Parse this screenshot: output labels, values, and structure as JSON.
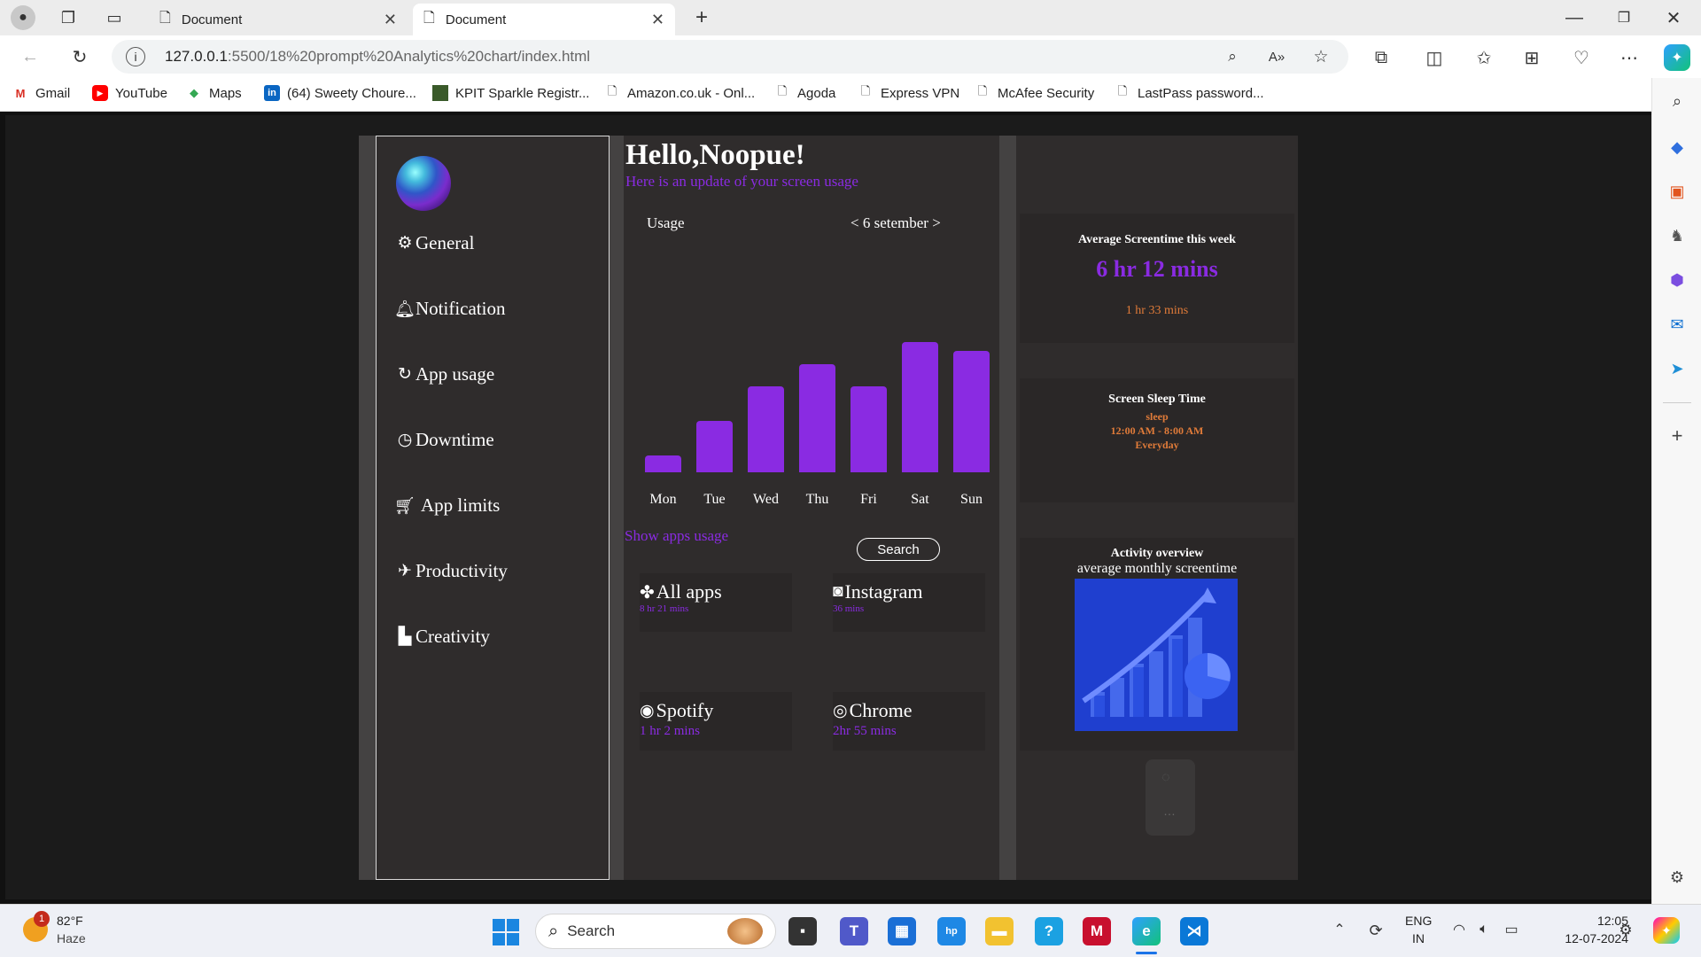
{
  "browser": {
    "tabs": [
      {
        "title": "Document"
      },
      {
        "title": "Document"
      }
    ],
    "url_host": "127.0.0.1",
    "url_rest": ":5500/18%20prompt%20Analytics%20chart/index.html",
    "bookmarks": [
      "Gmail",
      "YouTube",
      "Maps",
      "(64) Sweety Choure...",
      "KPIT Sparkle Registr...",
      "Amazon.co.uk - Onl...",
      "Agoda",
      "Express VPN",
      "McAfee Security",
      "LastPass password..."
    ]
  },
  "nav": {
    "items": [
      {
        "label": "General",
        "icon": "gear-icon"
      },
      {
        "label": "Notification",
        "icon": "bell-icon"
      },
      {
        "label": "App usage",
        "icon": "refresh-icon"
      },
      {
        "label": "Downtime",
        "icon": "clock-icon"
      },
      {
        "label": "App limits",
        "icon": "cart-icon"
      },
      {
        "label": "Productivity",
        "icon": "plane-icon"
      },
      {
        "label": "Creativity",
        "icon": "monitor-icon"
      }
    ]
  },
  "header": {
    "greeting": "Hello,Noopue!",
    "subtitle": "Here is an update of your screen usage"
  },
  "usage": {
    "title": "Usage",
    "date_label": "< 6 setember >"
  },
  "chart_data": {
    "type": "bar",
    "categories": [
      "Mon",
      "Tue",
      "Wed",
      "Thu",
      "Fri",
      "Sat",
      "Sun"
    ],
    "values": [
      13,
      40,
      67,
      84,
      67,
      101,
      94
    ],
    "ylim": [
      0,
      110
    ],
    "grid": false,
    "color": "#8a2be2"
  },
  "apps": {
    "heading": "Show apps usage",
    "search_label": "Search",
    "items": [
      {
        "name": "All apps",
        "time": "8 hr 21 mins",
        "icon": "apps-grid-icon"
      },
      {
        "name": "Instagram",
        "time": "36 mins",
        "icon": "instagram-icon"
      },
      {
        "name": "Spotify",
        "time": "1 hr 2 mins",
        "icon": "spotify-icon"
      },
      {
        "name": "Chrome",
        "time": "2hr 55 mins",
        "icon": "chrome-icon"
      }
    ]
  },
  "summary": {
    "avg_title": "Average Screentime this week",
    "avg_value": "6 hr 12 mins",
    "avg_sub": "1 hr 33 mins",
    "sleep_title": "Screen Sleep Time",
    "sleep_label": "sleep",
    "sleep_time": "12:00 AM - 8:00 AM",
    "sleep_days": "Everyday",
    "activity_title": "Activity overview",
    "activity_sub": "average monthly screentime"
  },
  "taskbar": {
    "weather_temp": "82°F",
    "weather_desc": "Haze",
    "weather_badge": "1",
    "search_placeholder": "Search",
    "lang_top": "ENG",
    "lang_bottom": "IN",
    "time": "12:05",
    "date": "12-07-2024"
  },
  "colors": {
    "accent": "#8a2be2",
    "orange": "#e07b39",
    "panel": "#2f2c2c"
  }
}
